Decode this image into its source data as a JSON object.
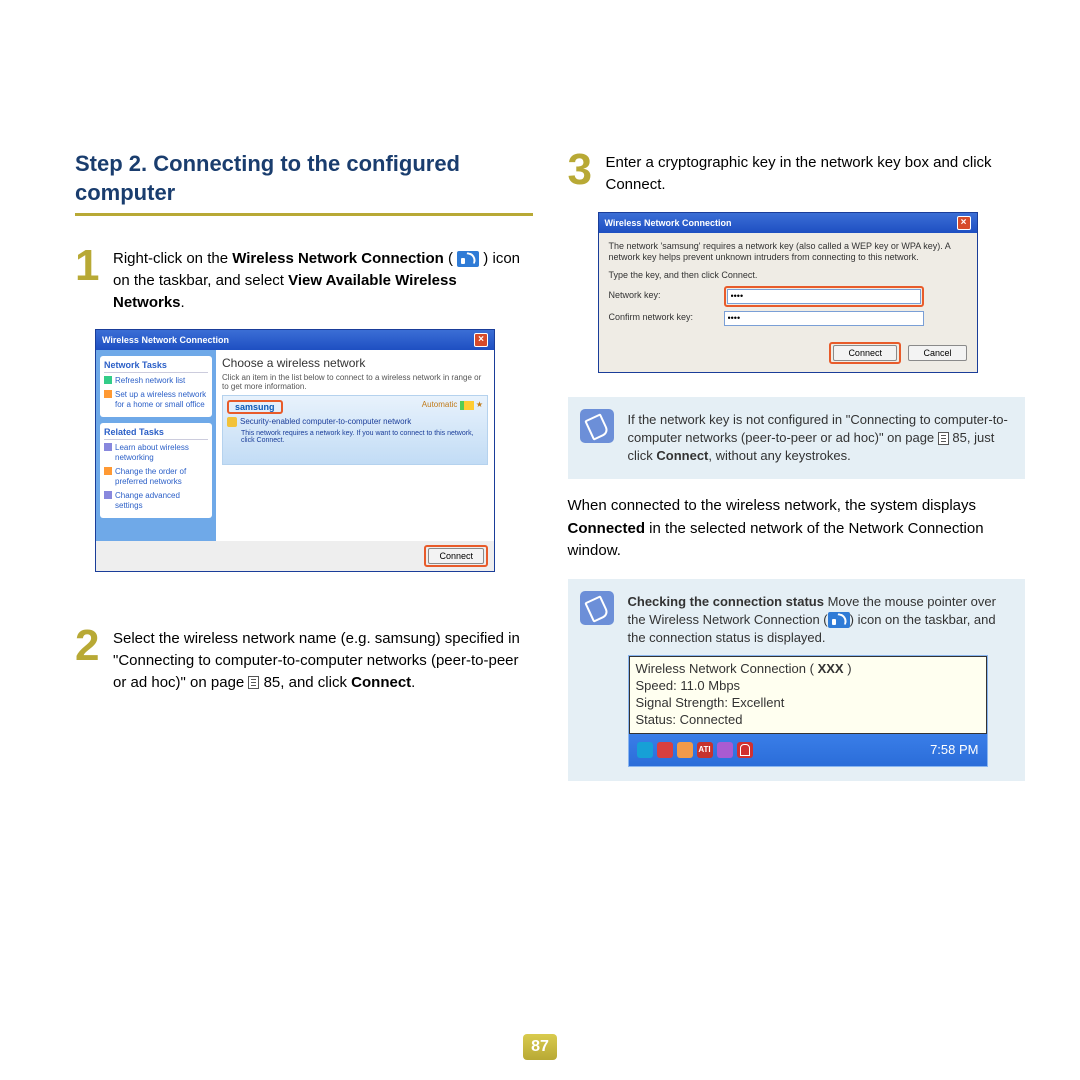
{
  "heading": "Step 2. Connecting to the configured computer",
  "step1": {
    "pre": "Right-click on the ",
    "b1": "Wireless Network Connection",
    "mid": " icon on the taskbar, and select ",
    "b2": "View Available Wireless Networks",
    "post": "."
  },
  "dlg1": {
    "title": "Wireless Network Connection",
    "side1_hdr": "Network Tasks",
    "side1_a": "Refresh network list",
    "side1_b": "Set up a wireless network for a home or small office",
    "side2_hdr": "Related Tasks",
    "side2_a": "Learn about wireless networking",
    "side2_b": "Change the order of preferred networks",
    "side2_c": "Change advanced settings",
    "main_hdr": "Choose a wireless network",
    "main_sub": "Click an item in the list below to connect to a wireless network in range or to get more information.",
    "net_name": "samsung",
    "net_auto": "Automatic",
    "net_desc": "Security-enabled computer-to-computer network",
    "net_desc2": "This network requires a network key. If you want to connect to this network, click Connect.",
    "connect": "Connect"
  },
  "step2": {
    "pre": "Select the wireless network name (e.g. samsung) specified in \"Connecting to computer-to-computer networks (peer-to-peer or ad hoc)\" on page ",
    "pg": "85",
    "mid": ", and click ",
    "b1": "Connect",
    "post": "."
  },
  "step3": "Enter a cryptographic key in the network key box and click Connect.",
  "dlg2": {
    "title": "Wireless Network Connection",
    "txt1": "The network 'samsung' requires a network key (also called a WEP key or WPA key). A network key helps prevent unknown intruders from connecting to this network.",
    "txt2": "Type the key, and then click Connect.",
    "lbl1": "Network key:",
    "lbl2": "Confirm network key:",
    "pw": "••••",
    "connect": "Connect",
    "cancel": "Cancel"
  },
  "note1": {
    "pre": "If the network key is not configured in \"Connecting to computer-to-computer networks (peer-to-peer or ad hoc)\" on page ",
    "pg": "85",
    "mid": ", just click ",
    "b1": "Connect",
    "post": ", without any keystrokes."
  },
  "para4": {
    "pre": "When connected to the wireless network, the system displays ",
    "b1": "Connected",
    "post": " in the selected network of the Network Connection window."
  },
  "note2": {
    "b1": "Checking the connection status",
    "pre": " Move the mouse pointer over the Wireless Network Connection (",
    "post": ") icon on the taskbar, and the connection status is displayed."
  },
  "tooltip": {
    "l1a": "Wireless Network Connection ( ",
    "l1b": "XXX",
    "l1c": " )",
    "l2": "Speed: 11.0 Mbps",
    "l3": "Signal Strength: Excellent",
    "l4a": "Status: ",
    "l4b": "Connected",
    "ati": "ATI",
    "time": "7:58 PM"
  },
  "pagenum": "87"
}
